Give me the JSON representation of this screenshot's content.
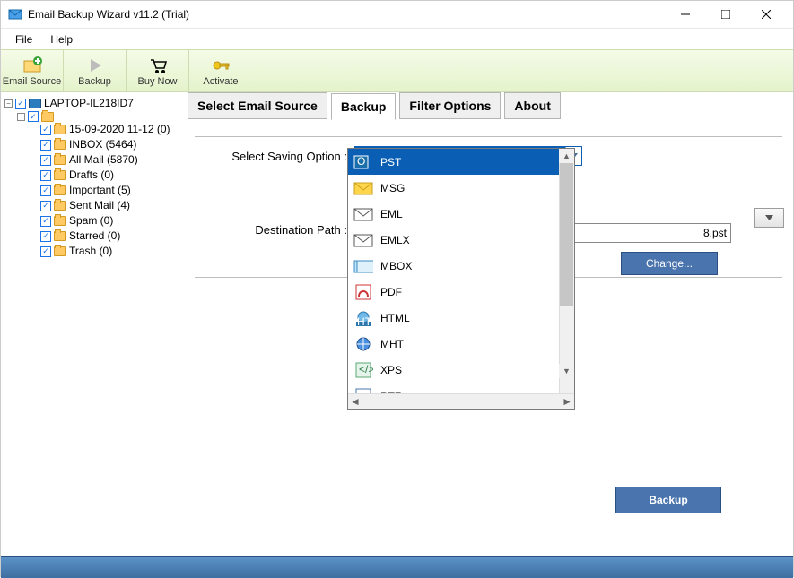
{
  "title": "Email Backup Wizard v11.2 (Trial)",
  "menu": {
    "file": "File",
    "help": "Help"
  },
  "toolbar": {
    "email_source": "Email Source",
    "backup": "Backup",
    "buy_now": "Buy Now",
    "activate": "Activate"
  },
  "tree": {
    "root": "LAPTOP-IL218ID7",
    "folders": [
      {
        "label": "15-09-2020 11-12 (0)"
      },
      {
        "label": "INBOX (5464)"
      },
      {
        "label": "All Mail (5870)"
      },
      {
        "label": "Drafts (0)"
      },
      {
        "label": "Important (5)"
      },
      {
        "label": "Sent Mail (4)"
      },
      {
        "label": "Spam (0)"
      },
      {
        "label": "Starred (0)"
      },
      {
        "label": "Trash (0)"
      }
    ]
  },
  "tabs": {
    "select_email_source": "Select Email Source",
    "backup": "Backup",
    "filter_options": "Filter Options",
    "about": "About"
  },
  "form": {
    "saving_label": "Select Saving Option :",
    "saving_value": "PST",
    "dest_label": "Destination Path :",
    "dest_value_visible": "8.pst",
    "change": "Change...",
    "backup_btn": "Backup"
  },
  "options": [
    {
      "name": "PST",
      "icon": "pst"
    },
    {
      "name": "MSG",
      "icon": "msg"
    },
    {
      "name": "EML",
      "icon": "eml"
    },
    {
      "name": "EMLX",
      "icon": "emlx"
    },
    {
      "name": "MBOX",
      "icon": "mbox"
    },
    {
      "name": "PDF",
      "icon": "pdf"
    },
    {
      "name": "HTML",
      "icon": "html"
    },
    {
      "name": "MHT",
      "icon": "mht"
    },
    {
      "name": "XPS",
      "icon": "xps"
    },
    {
      "name": "RTF",
      "icon": "rtf"
    }
  ]
}
